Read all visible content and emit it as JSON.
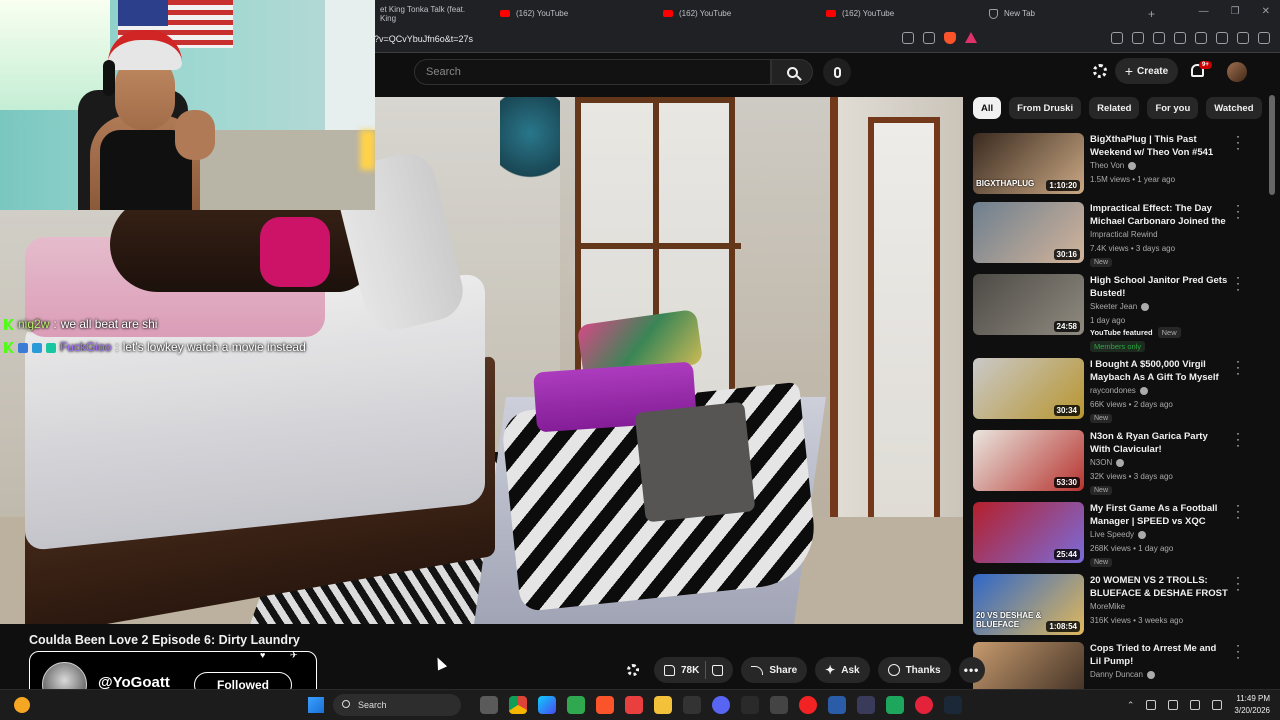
{
  "browser": {
    "tabs": [
      {
        "label": "et King Tonka Talk (feat. King",
        "icon": "youtube-icon"
      },
      {
        "label": "(162) YouTube",
        "icon": "youtube-icon"
      },
      {
        "label": "(162) YouTube",
        "icon": "youtube-icon"
      },
      {
        "label": "(162) YouTube",
        "icon": "youtube-icon"
      },
      {
        "label": "New Tab",
        "icon": "brave-shield-icon"
      }
    ],
    "url": "?v=QCvYbuJfn6o&t=27s"
  },
  "youtube": {
    "search_placeholder": "Search",
    "create_label": "Create",
    "notification_count": "9+",
    "accent": "#ff0000"
  },
  "chat": [
    {
      "user": "nig2w",
      "sep": ":",
      "message": "we all beat are shi",
      "color": "#b6f06c"
    },
    {
      "user": "FuckGioo",
      "sep": ":",
      "message": "let's lowkey watch a movie instead",
      "color": "#a771ff"
    }
  ],
  "video": {
    "title": "Coulda Been Love 2 Episode 6: Dirty Laundry",
    "like_count": "78K",
    "share_label": "Share",
    "ask_label": "Ask",
    "thanks_label": "Thanks"
  },
  "follow_card": {
    "handle": "@YoGoatt",
    "button_label": "Followed"
  },
  "filter_chips": [
    "All",
    "From Druski",
    "Related",
    "For you",
    "Watched"
  ],
  "recommendations": [
    {
      "title": "BigXthaPlug | This Past Weekend w/ Theo Von #541",
      "channel": "Theo Von",
      "verified": true,
      "meta": "1.5M views • 1 year ago",
      "duration": "1:10:20",
      "thumb_text": "BIGXTHAPLUG",
      "tag": "",
      "colors": [
        "#3a2a1f",
        "#caa884"
      ]
    },
    {
      "title": "Impractical Effect: The Day Michael Carbonaro Joined the ...",
      "channel": "Impractical Rewind",
      "verified": false,
      "meta": "7.4K views • 3 days ago",
      "duration": "30:16",
      "thumb_text": "",
      "tag": "New",
      "colors": [
        "#6d7f8f",
        "#d3b49a"
      ]
    },
    {
      "title": "High School Janitor Pred Gets Busted!",
      "channel": "Skeeter Jean",
      "verified": true,
      "meta": "1 day ago",
      "duration": "24:58",
      "thumb_text": "",
      "tag": "",
      "featured": "YouTube featured",
      "featured_new": "New",
      "members": "Members only",
      "colors": [
        "#4d4a46",
        "#8f8b80"
      ]
    },
    {
      "title": "I Bought A $500,000 Virgil Maybach As A Gift To Myself",
      "channel": "raycondones",
      "verified": true,
      "meta": "66K views • 2 days ago",
      "duration": "30:34",
      "thumb_text": "",
      "tag": "New",
      "colors": [
        "#c9c9c9",
        "#b8952e"
      ]
    },
    {
      "title": "N3on & Ryan Garica Party With Clavicular!",
      "channel": "N3ON",
      "verified": true,
      "meta": "32K views • 3 days ago",
      "duration": "53:30",
      "thumb_text": "",
      "tag": "New",
      "colors": [
        "#e9e6df",
        "#b7332f"
      ]
    },
    {
      "title": "My First Game As a Football Manager | SPEED vs XQC",
      "channel": "Live Speedy",
      "verified": true,
      "meta": "268K views • 1 day ago",
      "duration": "25:44",
      "thumb_text": "",
      "tag": "New",
      "colors": [
        "#b51f2b",
        "#7a6cdb"
      ]
    },
    {
      "title": "20 WOMEN VS 2 TROLLS: BLUEFACE & DESHAE FROST",
      "channel": "MoreMike",
      "verified": false,
      "meta": "316K views • 3 weeks ago",
      "duration": "1:08:54",
      "thumb_text": "20 VS DESHAE & BLUEFACE",
      "tag": "",
      "colors": [
        "#2f67c8",
        "#e1b85b"
      ]
    },
    {
      "title": "Cops Tried to Arrest Me and Lil Pump!",
      "channel": "Danny Duncan",
      "verified": true,
      "meta": "",
      "duration": "",
      "thumb_text": "",
      "tag": "",
      "colors": [
        "#c69a6e",
        "#3b2c22"
      ]
    }
  ],
  "taskbar": {
    "search_label": "Search",
    "time": "11:49 PM",
    "date": "3/20/2026"
  }
}
